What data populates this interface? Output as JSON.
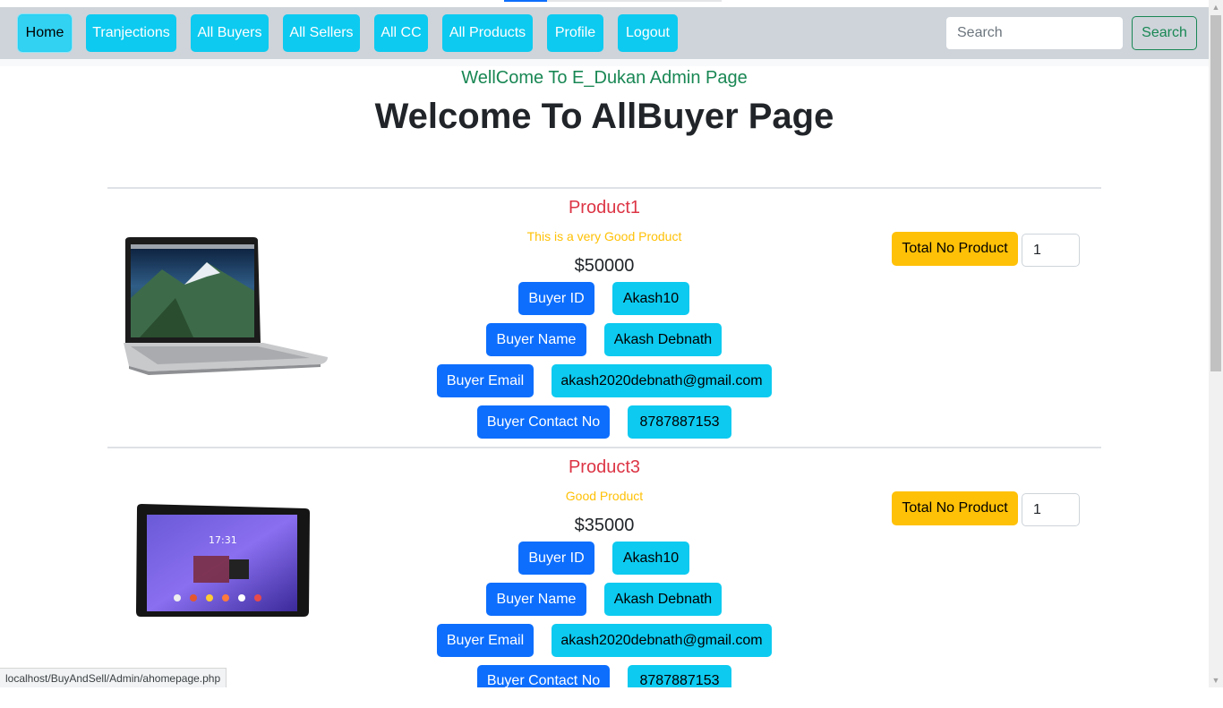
{
  "nav": {
    "items": [
      {
        "label": "Home"
      },
      {
        "label": "Tranjections"
      },
      {
        "label": "All Buyers"
      },
      {
        "label": "All Sellers"
      },
      {
        "label": "All CC"
      },
      {
        "label": "All Products"
      },
      {
        "label": "Profile"
      },
      {
        "label": "Logout"
      }
    ],
    "search_placeholder": "Search",
    "search_button": "Search"
  },
  "header": {
    "admin_heading": "WellCome To E_Dukan Admin Page",
    "page_title": "Welcome To AllBuyer Page"
  },
  "products": [
    {
      "name": "Product1",
      "description": "This is a very Good Product",
      "price": "$50000",
      "image_icon": "laptop-image",
      "buyer_id_label": "Buyer ID",
      "buyer_id": "Akash10",
      "buyer_name_label": "Buyer Name",
      "buyer_name": "Akash Debnath",
      "buyer_email_label": "Buyer Email",
      "buyer_email": "akash2020debnath@gmail.com",
      "buyer_contact_label": "Buyer Contact No",
      "buyer_contact": "8787887153",
      "total_label": "Total No Product",
      "total_value": "1"
    },
    {
      "name": "Product3",
      "description": "Good Product",
      "price": "$35000",
      "image_icon": "tablet-image",
      "buyer_id_label": "Buyer ID",
      "buyer_id": "Akash10",
      "buyer_name_label": "Buyer Name",
      "buyer_name": "Akash Debnath",
      "buyer_email_label": "Buyer Email",
      "buyer_email": "akash2020debnath@gmail.com",
      "buyer_contact_label": "Buyer Contact No",
      "buyer_contact": "8787887153",
      "total_label": "Total No Product",
      "total_value": "1"
    }
  ],
  "tablet_clock": "17:31",
  "status_bar": {
    "url": "localhost/BuyAndSell/Admin/ahomepage.php"
  },
  "colors": {
    "nav_bg": "#ced4da",
    "info": "#0dcaf0",
    "primary": "#0d6efd",
    "warning": "#ffc107",
    "danger": "#dc3545",
    "success": "#198754"
  }
}
